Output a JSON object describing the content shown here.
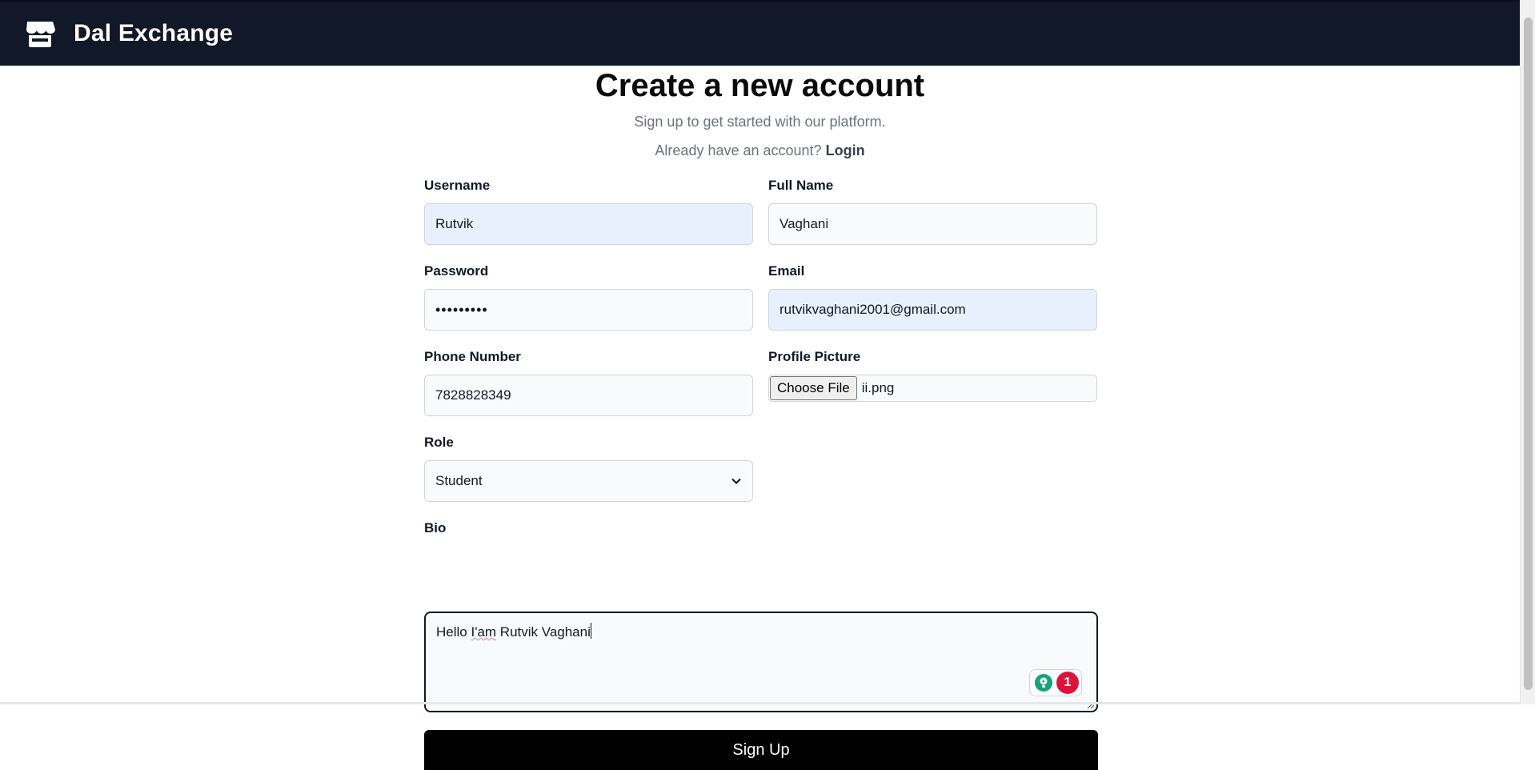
{
  "header": {
    "brand_icon": "store-icon",
    "brand_name": "Dal Exchange",
    "background": "#111827"
  },
  "intro": {
    "title": "Create a new account",
    "subtitle": "Sign up to get started with our platform.",
    "login_prompt": "Already have an account?",
    "login_link": "Login"
  },
  "form": {
    "username": {
      "label": "Username",
      "value": "Rutvik"
    },
    "full_name": {
      "label": "Full Name",
      "value": "Vaghani"
    },
    "password": {
      "label": "Password",
      "value": "•••••••••"
    },
    "email": {
      "label": "Email",
      "value": "rutvikvaghani2001@gmail.com"
    },
    "phone": {
      "label": "Phone Number",
      "value": "7828828349"
    },
    "profile_picture": {
      "label": "Profile Picture",
      "button": "Choose File",
      "file_name": "ii.png"
    },
    "role": {
      "label": "Role",
      "selected": "Student"
    },
    "bio": {
      "label": "Bio",
      "value_part1": "Hello ",
      "value_flagged": "I'am",
      "value_part2": " Rutvik Vaghani"
    },
    "grammar_badge_count": "1",
    "submit_label": "Sign Up"
  },
  "colors": {
    "autofill_bg": "#e8f0fe",
    "button_bg": "#000000",
    "grammar_badge": "#dc143c",
    "grammar_icon": "#15a37a"
  }
}
